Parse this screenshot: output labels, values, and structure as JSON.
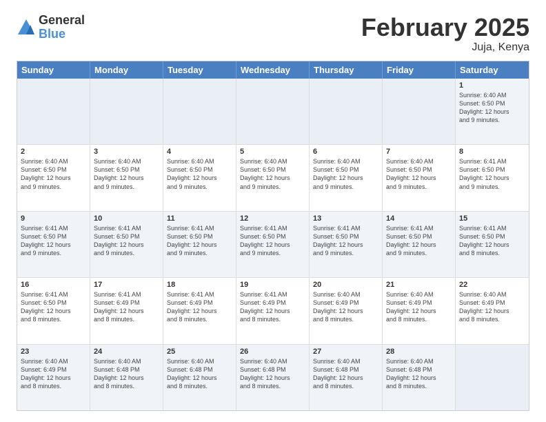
{
  "logo": {
    "general": "General",
    "blue": "Blue"
  },
  "title": "February 2025",
  "location": "Juja, Kenya",
  "days": [
    "Sunday",
    "Monday",
    "Tuesday",
    "Wednesday",
    "Thursday",
    "Friday",
    "Saturday"
  ],
  "weeks": [
    [
      {
        "day": "",
        "info": ""
      },
      {
        "day": "",
        "info": ""
      },
      {
        "day": "",
        "info": ""
      },
      {
        "day": "",
        "info": ""
      },
      {
        "day": "",
        "info": ""
      },
      {
        "day": "",
        "info": ""
      },
      {
        "day": "1",
        "info": "Sunrise: 6:40 AM\nSunset: 6:50 PM\nDaylight: 12 hours\nand 9 minutes."
      }
    ],
    [
      {
        "day": "2",
        "info": "Sunrise: 6:40 AM\nSunset: 6:50 PM\nDaylight: 12 hours\nand 9 minutes."
      },
      {
        "day": "3",
        "info": "Sunrise: 6:40 AM\nSunset: 6:50 PM\nDaylight: 12 hours\nand 9 minutes."
      },
      {
        "day": "4",
        "info": "Sunrise: 6:40 AM\nSunset: 6:50 PM\nDaylight: 12 hours\nand 9 minutes."
      },
      {
        "day": "5",
        "info": "Sunrise: 6:40 AM\nSunset: 6:50 PM\nDaylight: 12 hours\nand 9 minutes."
      },
      {
        "day": "6",
        "info": "Sunrise: 6:40 AM\nSunset: 6:50 PM\nDaylight: 12 hours\nand 9 minutes."
      },
      {
        "day": "7",
        "info": "Sunrise: 6:40 AM\nSunset: 6:50 PM\nDaylight: 12 hours\nand 9 minutes."
      },
      {
        "day": "8",
        "info": "Sunrise: 6:41 AM\nSunset: 6:50 PM\nDaylight: 12 hours\nand 9 minutes."
      }
    ],
    [
      {
        "day": "9",
        "info": "Sunrise: 6:41 AM\nSunset: 6:50 PM\nDaylight: 12 hours\nand 9 minutes."
      },
      {
        "day": "10",
        "info": "Sunrise: 6:41 AM\nSunset: 6:50 PM\nDaylight: 12 hours\nand 9 minutes."
      },
      {
        "day": "11",
        "info": "Sunrise: 6:41 AM\nSunset: 6:50 PM\nDaylight: 12 hours\nand 9 minutes."
      },
      {
        "day": "12",
        "info": "Sunrise: 6:41 AM\nSunset: 6:50 PM\nDaylight: 12 hours\nand 9 minutes."
      },
      {
        "day": "13",
        "info": "Sunrise: 6:41 AM\nSunset: 6:50 PM\nDaylight: 12 hours\nand 9 minutes."
      },
      {
        "day": "14",
        "info": "Sunrise: 6:41 AM\nSunset: 6:50 PM\nDaylight: 12 hours\nand 9 minutes."
      },
      {
        "day": "15",
        "info": "Sunrise: 6:41 AM\nSunset: 6:50 PM\nDaylight: 12 hours\nand 8 minutes."
      }
    ],
    [
      {
        "day": "16",
        "info": "Sunrise: 6:41 AM\nSunset: 6:50 PM\nDaylight: 12 hours\nand 8 minutes."
      },
      {
        "day": "17",
        "info": "Sunrise: 6:41 AM\nSunset: 6:49 PM\nDaylight: 12 hours\nand 8 minutes."
      },
      {
        "day": "18",
        "info": "Sunrise: 6:41 AM\nSunset: 6:49 PM\nDaylight: 12 hours\nand 8 minutes."
      },
      {
        "day": "19",
        "info": "Sunrise: 6:41 AM\nSunset: 6:49 PM\nDaylight: 12 hours\nand 8 minutes."
      },
      {
        "day": "20",
        "info": "Sunrise: 6:40 AM\nSunset: 6:49 PM\nDaylight: 12 hours\nand 8 minutes."
      },
      {
        "day": "21",
        "info": "Sunrise: 6:40 AM\nSunset: 6:49 PM\nDaylight: 12 hours\nand 8 minutes."
      },
      {
        "day": "22",
        "info": "Sunrise: 6:40 AM\nSunset: 6:49 PM\nDaylight: 12 hours\nand 8 minutes."
      }
    ],
    [
      {
        "day": "23",
        "info": "Sunrise: 6:40 AM\nSunset: 6:49 PM\nDaylight: 12 hours\nand 8 minutes."
      },
      {
        "day": "24",
        "info": "Sunrise: 6:40 AM\nSunset: 6:48 PM\nDaylight: 12 hours\nand 8 minutes."
      },
      {
        "day": "25",
        "info": "Sunrise: 6:40 AM\nSunset: 6:48 PM\nDaylight: 12 hours\nand 8 minutes."
      },
      {
        "day": "26",
        "info": "Sunrise: 6:40 AM\nSunset: 6:48 PM\nDaylight: 12 hours\nand 8 minutes."
      },
      {
        "day": "27",
        "info": "Sunrise: 6:40 AM\nSunset: 6:48 PM\nDaylight: 12 hours\nand 8 minutes."
      },
      {
        "day": "28",
        "info": "Sunrise: 6:40 AM\nSunset: 6:48 PM\nDaylight: 12 hours\nand 8 minutes."
      },
      {
        "day": "",
        "info": ""
      }
    ]
  ],
  "alt_rows": [
    0,
    2,
    4
  ],
  "colors": {
    "header_bg": "#4a7fc1",
    "alt_row_bg": "#e8eef5",
    "border": "#cccccc"
  }
}
